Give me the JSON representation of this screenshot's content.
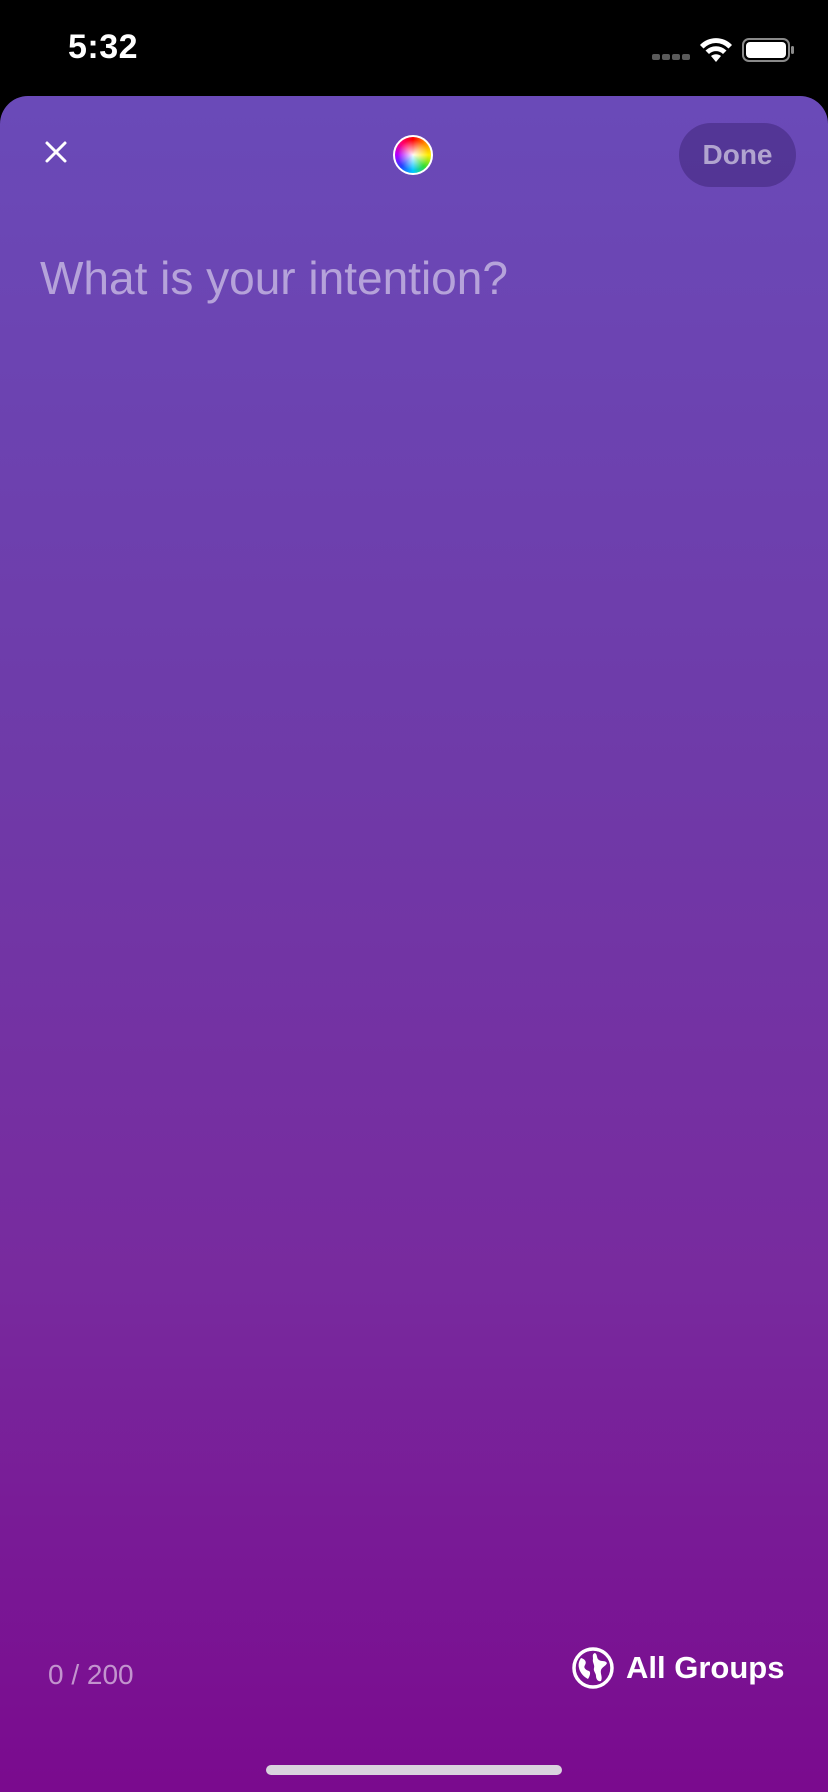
{
  "status_bar": {
    "time": "5:32",
    "signal_icon": "cellular-signal-icon",
    "wifi_icon": "wifi-icon",
    "battery_icon": "battery-icon"
  },
  "header": {
    "close_icon": "close-icon",
    "color_picker_icon": "color-wheel-icon",
    "done_label": "Done"
  },
  "composer": {
    "placeholder": "What is your intention?",
    "value": ""
  },
  "footer": {
    "char_count": "0 / 200",
    "audience_icon": "globe-icon",
    "audience_label": "All Groups"
  },
  "colors": {
    "gradient_top": "#6a4ab8",
    "gradient_bottom": "#7a0a8e",
    "status_bar_bg": "#000000",
    "done_bg": "rgba(40,20,90,0.35)"
  }
}
